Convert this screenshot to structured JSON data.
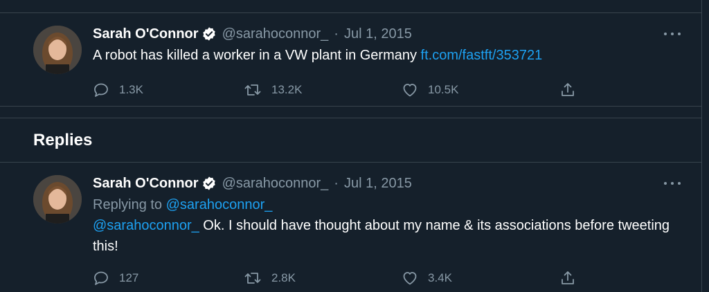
{
  "tweets": [
    {
      "author_name": "Sarah O'Connor",
      "handle": "@sarahoconnor_",
      "separator": "·",
      "date": "Jul 1, 2015",
      "text_prefix": "A robot has killed a worker in a VW plant in Germany ",
      "link": "ft.com/fastft/353721",
      "replies": "1.3K",
      "retweets": "13.2K",
      "likes": "10.5K"
    },
    {
      "author_name": "Sarah O'Connor",
      "handle": "@sarahoconnor_",
      "separator": "·",
      "date": "Jul 1, 2015",
      "replying_prefix": "Replying to ",
      "replying_to": "@sarahoconnor_",
      "mention": "@sarahoconnor_",
      "text_body": " Ok. I should have thought about my name & its associations before tweeting this!",
      "replies": "127",
      "retweets": "2.8K",
      "likes": "3.4K"
    }
  ],
  "section": {
    "replies_title": "Replies"
  },
  "icons": {
    "verified": "verified-badge-icon",
    "more": "more-horizontal-icon",
    "reply": "reply-bubble-icon",
    "retweet": "retweet-icon",
    "like": "heart-icon",
    "share": "share-icon"
  },
  "colors": {
    "background": "#15202b",
    "border": "#38444d",
    "secondary_text": "#8899a6",
    "link": "#1da1f2"
  }
}
